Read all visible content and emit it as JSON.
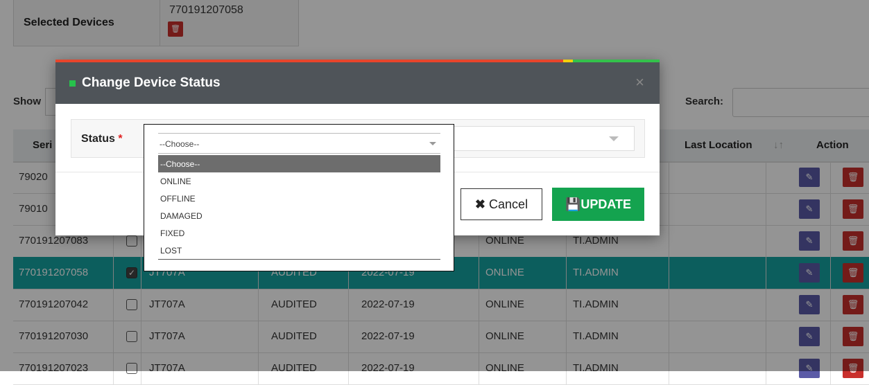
{
  "selected": {
    "label": "Selected Devices",
    "device": "770191207058"
  },
  "table_controls": {
    "show_label": "Show",
    "search_label": "Search:"
  },
  "table": {
    "headers": {
      "serial": "Seri",
      "last_location": "Last Location",
      "action": "Action"
    },
    "rows": [
      {
        "serial": "79020",
        "checked": false,
        "model": "",
        "audit": "",
        "date": "",
        "status": "",
        "user": ""
      },
      {
        "serial": "79010",
        "checked": false,
        "model": "",
        "audit": "",
        "date": "",
        "status": "",
        "user": ""
      },
      {
        "serial": "770191207083",
        "checked": false,
        "model": "",
        "audit": "",
        "date": "",
        "status": "ONLINE",
        "user": "TI.ADMIN"
      },
      {
        "serial": "770191207058",
        "checked": true,
        "model": "JT707A",
        "audit": "AUDITED",
        "date": "2022-07-19",
        "status": "ONLINE",
        "user": "TI.ADMIN"
      },
      {
        "serial": "770191207042",
        "checked": false,
        "model": "JT707A",
        "audit": "AUDITED",
        "date": "2022-07-19",
        "status": "ONLINE",
        "user": "TI.ADMIN"
      },
      {
        "serial": "770191207030",
        "checked": false,
        "model": "JT707A",
        "audit": "AUDITED",
        "date": "2022-07-19",
        "status": "ONLINE",
        "user": "TI.ADMIN"
      },
      {
        "serial": "770191207023",
        "checked": false,
        "model": "JT707A",
        "audit": "AUDITED",
        "date": "2022-07-19",
        "status": "ONLINE",
        "user": "TI.ADMIN"
      }
    ]
  },
  "modal": {
    "title": "Change Device Status",
    "close_icon": "×",
    "status_label": "Status",
    "required_mark": "*",
    "cancel_label": "Cancel",
    "update_label": "UPDATE"
  },
  "dropdown": {
    "current": "--Choose--",
    "options": [
      "--Choose--",
      "ONLINE",
      "OFFLINE",
      "DAMAGED",
      "FIXED",
      "LOST"
    ],
    "highlighted": "--Choose--"
  },
  "colors": {
    "update": "#14a34f",
    "selected_row": "#16a2a0",
    "edit": "#5b5ba7",
    "delete": "#c9302c"
  },
  "icons": {
    "edit": "edit-icon",
    "trash": "trash-icon",
    "cancel": "x-icon",
    "save": "floppy-icon"
  }
}
